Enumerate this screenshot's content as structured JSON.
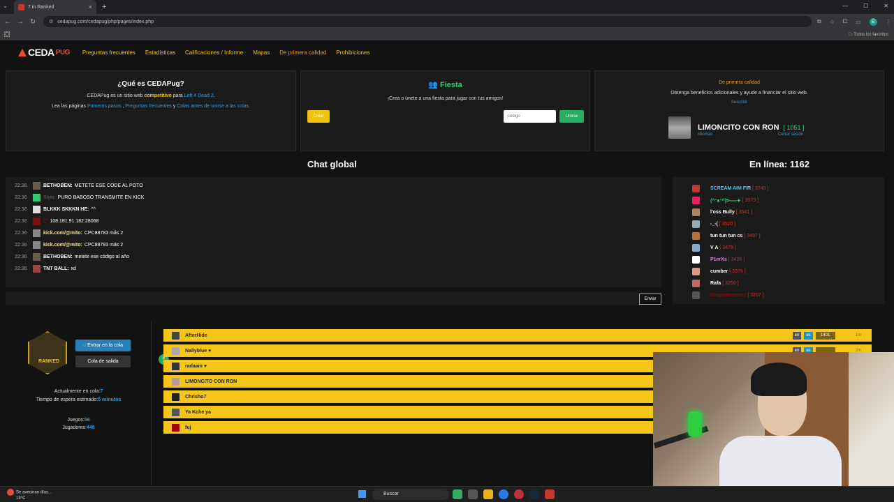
{
  "browser": {
    "tab_title": "7 in Ranked",
    "url": "cedapug.com/cedapug/php/pages/index.php",
    "bookmarks_folder": "Todos los favoritos",
    "profile_initial": "E"
  },
  "nav": {
    "logo": "CEDA",
    "logo_suffix": "PUG",
    "links": [
      "Preguntas frecuentes",
      "Estadísticas",
      "Calificaciones / Informe",
      "Mapas",
      "De primera calidad",
      "Prohibiciones"
    ]
  },
  "about": {
    "title": "¿Qué es CEDAPug?",
    "l1_a": "CEDAPug es un sitio web ",
    "l1_b": "competitivo",
    "l1_c": " para ",
    "l1_d": "Left 4 Dead 2",
    "l1_e": ".",
    "l2_a": "Lea las páginas ",
    "l2_b": "Primeros pasos",
    "l2_c": " , ",
    "l2_d": "Preguntas frecuentes",
    "l2_e": " y ",
    "l2_f": "Colas antes de unirse a las colas."
  },
  "party": {
    "title": "Fiesta",
    "subtitle": "¡Crea o únete a una fiesta para jugar con tus amigos!",
    "create": "Crear",
    "code_placeholder": "código",
    "join": "Unirse"
  },
  "premium": {
    "title": "De primera calidad",
    "text": "Obtenga beneficios adicionales y ayude a financiar el sitio web.",
    "subscribe": "Suscribir",
    "user": "LIMONCITO CON RON",
    "rating": "[ 1051 ]",
    "languages": "Idiomas",
    "logout": "Cerrar sesión"
  },
  "chat": {
    "title": "Chat global",
    "online_label": "En línea: 1162",
    "send": "Enviar",
    "messages": [
      {
        "time": "22:36",
        "name": "BETHOBEN:",
        "msg": "METETE ESE CODE AL POTO",
        "style": "n",
        "av": "#6b5b4b"
      },
      {
        "time": "22:36",
        "name": "Stylo:",
        "msg": "PURO BABOSO TRANSMITE EN KICK",
        "style": "dim",
        "av": "#2ecc71"
      },
      {
        "time": "22:36",
        "name": "BLKKK SKKKN HE:",
        "msg": "^^",
        "style": "n",
        "av": "#ddd"
      },
      {
        "time": "22:36",
        "name": "ζ^",
        "msg": "108.181.91.182:28068",
        "style": "red",
        "av": "#7a1010"
      },
      {
        "time": "22:36",
        "name": "kick.com/@mito:",
        "msg": "CPC88783 más 2",
        "style": "hl",
        "av": "#888"
      },
      {
        "time": "22:36",
        "name": "kick.com/@mito:",
        "msg": "CPC88783 más 2",
        "style": "hl",
        "av": "#888"
      },
      {
        "time": "22:36",
        "name": "BETHOBEN:",
        "msg": "metete ese código al año",
        "style": "n",
        "av": "#6b5b4b"
      },
      {
        "time": "22:36",
        "name": "TNT BALL:",
        "msg": "xd",
        "style": "n",
        "av": "#a04040"
      }
    ],
    "online_users": [
      {
        "name": "SCREAM AIM FIR",
        "rating": "[ 3745 ]",
        "color": "#4fc3f7",
        "av": "#c0392b"
      },
      {
        "name": "(^ᵔᴥᵔ^)ᕗ══✦",
        "rating": "[ 3575 ]",
        "color": "#2ecc71",
        "av": "#e91e63"
      },
      {
        "name": "l'oss Bully",
        "rating": "[ 3541 ]",
        "color": "#fff",
        "av": "#b08060"
      },
      {
        "name": "-_-(",
        "rating": "[ 3520 ]",
        "color": "#fff",
        "av": "#9ab"
      },
      {
        "name": "tun tun tun cs",
        "rating": "[ 3497 ]",
        "color": "#fff",
        "av": "#c07030"
      },
      {
        "name": "V A",
        "rating": "[ 3479 ]",
        "color": "#fff",
        "av": "#8ac"
      },
      {
        "name": "P1erXs",
        "rating": "[ 3426 ]",
        "color": "#e67ee6",
        "av": "#fff"
      },
      {
        "name": "cumber",
        "rating": "[ 3375 ]",
        "color": "#fff",
        "av": "#d98"
      },
      {
        "name": "Rafa",
        "rating": "[ 3250 ]",
        "color": "#fff",
        "av": "#c66"
      },
      {
        "name": "Dragontempest",
        "rating": "[ 3207 ]",
        "color": "#7a1010",
        "av": "#555"
      }
    ]
  },
  "queue": {
    "rank": "RANKED",
    "enter": "Entrar en la cola",
    "leave": "Cola de salida",
    "in_queue_label": "Actualmente en cola:",
    "in_queue_value": "7",
    "wait_label": "Tiempo de espera estimado:",
    "wait_value": "5 minutos",
    "games_label": "Juegos:",
    "games_value": "56",
    "players_label": "Jugadores:",
    "players_value": "448",
    "party_badge": "P",
    "players": [
      {
        "name": "AfterHide",
        "lang1": "en",
        "lang2": "es",
        "elo": "1401",
        "time": "1m",
        "av": "#444"
      },
      {
        "name": "Nallyblue ♥",
        "lang1": "en",
        "lang2": "es",
        "elo": "",
        "time": "2m",
        "av": "#aaa"
      },
      {
        "name": "radaam ♥",
        "lang1": "",
        "lang2": "",
        "elo": "",
        "time": "",
        "av": "#333"
      },
      {
        "name": "LIMONCITO CON RON",
        "lang1": "",
        "lang2": "",
        "elo": "",
        "time": "",
        "av": "#b99"
      },
      {
        "name": "Chrisho7",
        "lang1": "",
        "lang2": "",
        "elo": "",
        "time": "",
        "av": "#222"
      },
      {
        "name": "Ya Kche ya",
        "lang1": "",
        "lang2": "",
        "elo": "",
        "time": "",
        "av": "#555"
      },
      {
        "name": "fuj",
        "lang1": "",
        "lang2": "",
        "elo": "",
        "time": "",
        "av": "#a00"
      }
    ]
  },
  "taskbar": {
    "weather_line1": "Se avecinan días...",
    "weather_line2": "19°C",
    "search": "Buscar"
  }
}
